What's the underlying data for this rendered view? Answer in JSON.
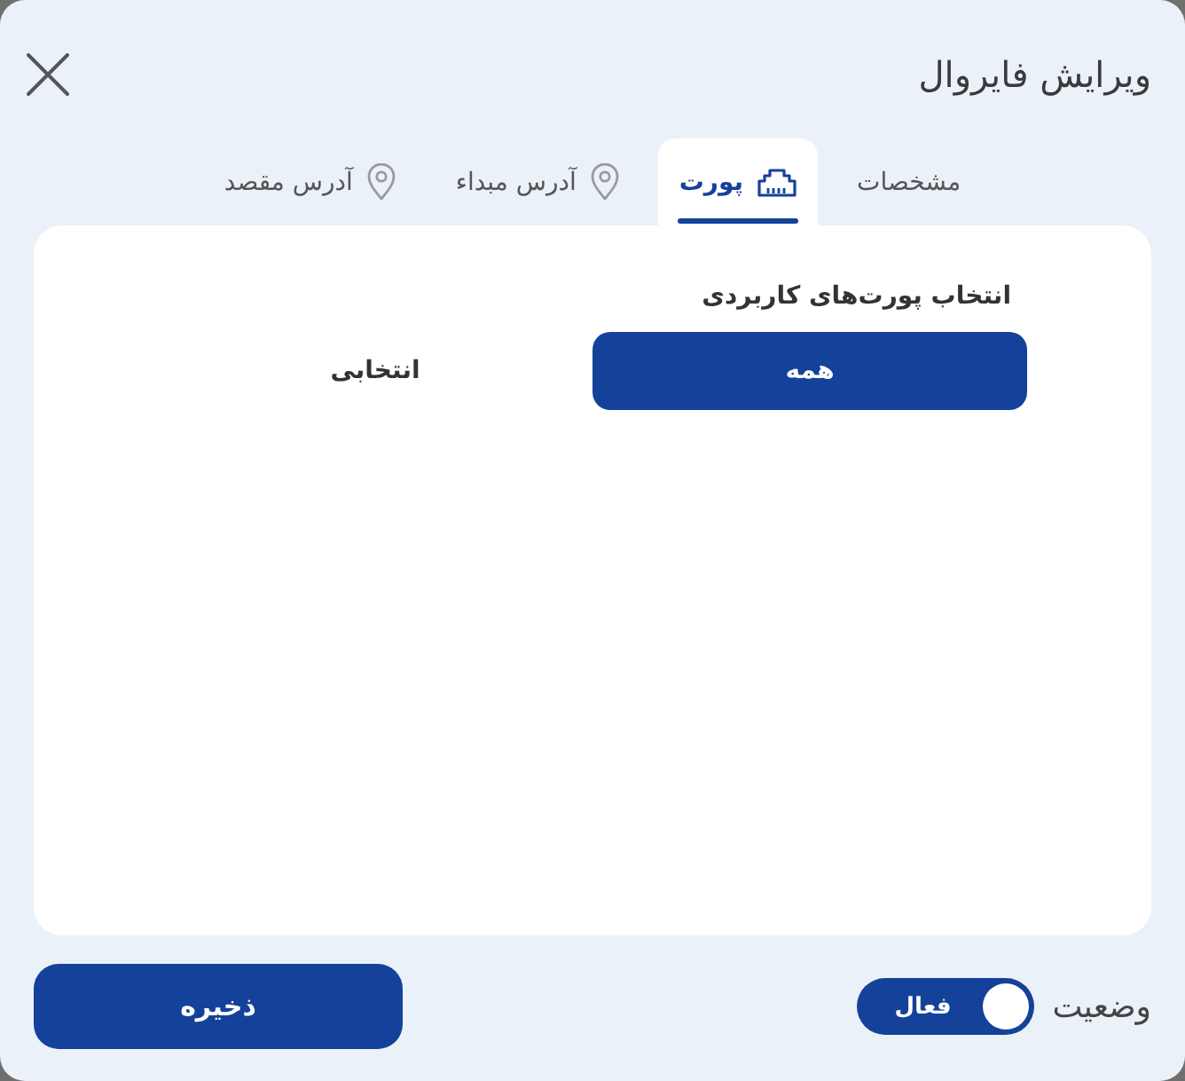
{
  "dialog": {
    "title": "ویرایش فایروال"
  },
  "tabs": [
    {
      "label": "مشخصات",
      "kind": "text",
      "selected": false
    },
    {
      "label": "پورت",
      "kind": "port",
      "selected": true
    },
    {
      "label": "آدرس مبداء",
      "kind": "address",
      "selected": false
    },
    {
      "label": "آدرس مقصد",
      "kind": "address",
      "selected": false
    }
  ],
  "port_selection": {
    "label": "انتخاب پورت‌های کاربردی",
    "options": [
      {
        "label": "همه",
        "selected": true
      },
      {
        "label": "انتخابی",
        "selected": false
      }
    ]
  },
  "footer": {
    "status": {
      "label": "وضعیت",
      "toggle": {
        "on": true,
        "text": "فعال"
      }
    },
    "save_button": "ذخیره"
  }
}
